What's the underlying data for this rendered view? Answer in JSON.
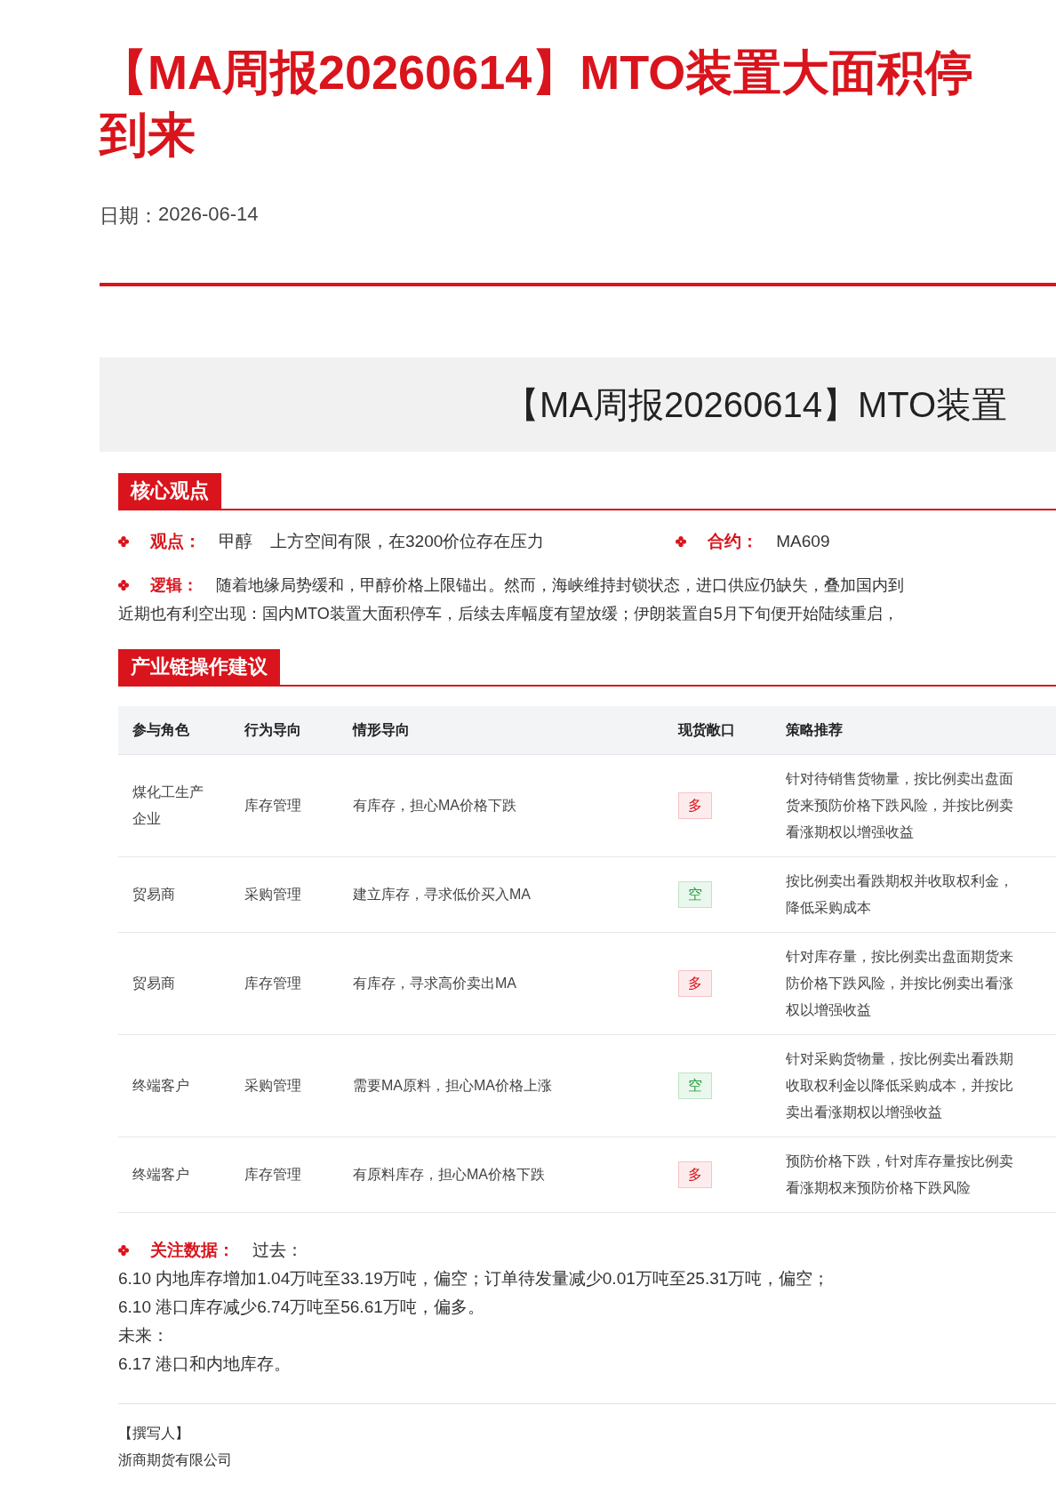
{
  "title_lines": [
    "【MA周报20260614】MTO装置大面积停",
    "到来"
  ],
  "date": {
    "label": "日期：",
    "value": "2026-06-14"
  },
  "banner": {
    "title": "【MA周报20260614】MTO装置"
  },
  "sections": [
    {
      "heading": "核心观点",
      "view": {
        "label": "观点：",
        "commodity": "甲醇",
        "text": "上方空间有限，在3200价位存在压力"
      },
      "contract": {
        "label": "合约：",
        "value": "MA609"
      },
      "logic": {
        "label": "逻辑：",
        "lines": [
          "随着地缘局势缓和，甲醇价格上限锚出。然而，海峡维持封锁状态，进口供应仍缺失，叠加国内到",
          "近期也有利空出现：国内MTO装置大面积停车，后续去库幅度有望放缓；伊朗装置自5月下旬便开始陆续重启，"
        ]
      }
    },
    {
      "heading": "产业链操作建议",
      "table": {
        "columns": [
          "参与角色",
          "行为导向",
          "情形导向",
          "现货敞口",
          "策略推荐"
        ],
        "rows": [
          {
            "role": [
              "煤化工生产",
              "企业"
            ],
            "behavior": "库存管理",
            "situation": "有库存，担心MA价格下跌",
            "exposure": {
              "text": "多",
              "kind": "long"
            },
            "strategy": [
              "针对待销售货物量，按比例卖出盘面",
              "货来预防价格下跌风险，并按比例卖",
              "看涨期权以增强收益"
            ]
          },
          {
            "role": [
              "贸易商"
            ],
            "behavior": "采购管理",
            "situation": "建立库存，寻求低价买入MA",
            "exposure": {
              "text": "空",
              "kind": "short"
            },
            "strategy": [
              "按比例卖出看跌期权并收取权利金，",
              "降低采购成本"
            ]
          },
          {
            "role": [
              "贸易商"
            ],
            "behavior": "库存管理",
            "situation": "有库存，寻求高价卖出MA",
            "exposure": {
              "text": "多",
              "kind": "long"
            },
            "strategy": [
              "针对库存量，按比例卖出盘面期货来",
              "防价格下跌风险，并按比例卖出看涨",
              "权以增强收益"
            ]
          },
          {
            "role": [
              "终端客户"
            ],
            "behavior": "采购管理",
            "situation": "需要MA原料，担心MA价格上涨",
            "exposure": {
              "text": "空",
              "kind": "short"
            },
            "strategy": [
              "针对采购货物量，按比例卖出看跌期",
              "收取权利金以降低采购成本，并按比",
              "卖出看涨期权以增强收益"
            ]
          },
          {
            "role": [
              "终端客户"
            ],
            "behavior": "库存管理",
            "situation": "有原料库存，担心MA价格下跌",
            "exposure": {
              "text": "多",
              "kind": "long"
            },
            "strategy": [
              "预防价格下跌，针对库存量按比例卖",
              "看涨期权来预防价格下跌风险"
            ]
          }
        ]
      },
      "watch": {
        "label": "关注数据：",
        "intro": "过去：",
        "lines": [
          "6.10 内地库存增加1.04万吨至33.19万吨，偏空；订单待发量减少0.01万吨至25.31万吨，偏空；",
          "6.10 港口库存减少6.74万吨至56.61万吨，偏多。",
          "未来：",
          "6.17 港口和内地库存。"
        ]
      }
    }
  ],
  "author": {
    "label": "【撰写人】",
    "company": "浙商期货有限公司"
  }
}
